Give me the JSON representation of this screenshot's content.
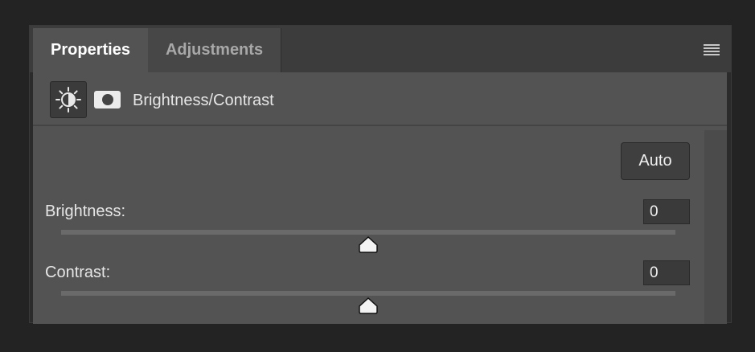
{
  "tabs": [
    {
      "label": "Properties",
      "active": true
    },
    {
      "label": "Adjustments",
      "active": false
    }
  ],
  "header": {
    "adjustment_icon": "brightness-contrast-icon",
    "mask_icon": "layer-mask-icon",
    "title": "Brightness/Contrast"
  },
  "auto_button": {
    "label": "Auto"
  },
  "controls": {
    "brightness": {
      "label": "Brightness:",
      "value": "0",
      "slider_fraction": 0.5
    },
    "contrast": {
      "label": "Contrast:",
      "value": "0",
      "slider_fraction": 0.5
    }
  },
  "colors": {
    "panel_bg": "#535353",
    "tab_bar_bg": "#3c3c3c",
    "field_bg": "#3a3a3a",
    "text": "#e6e6e6"
  }
}
